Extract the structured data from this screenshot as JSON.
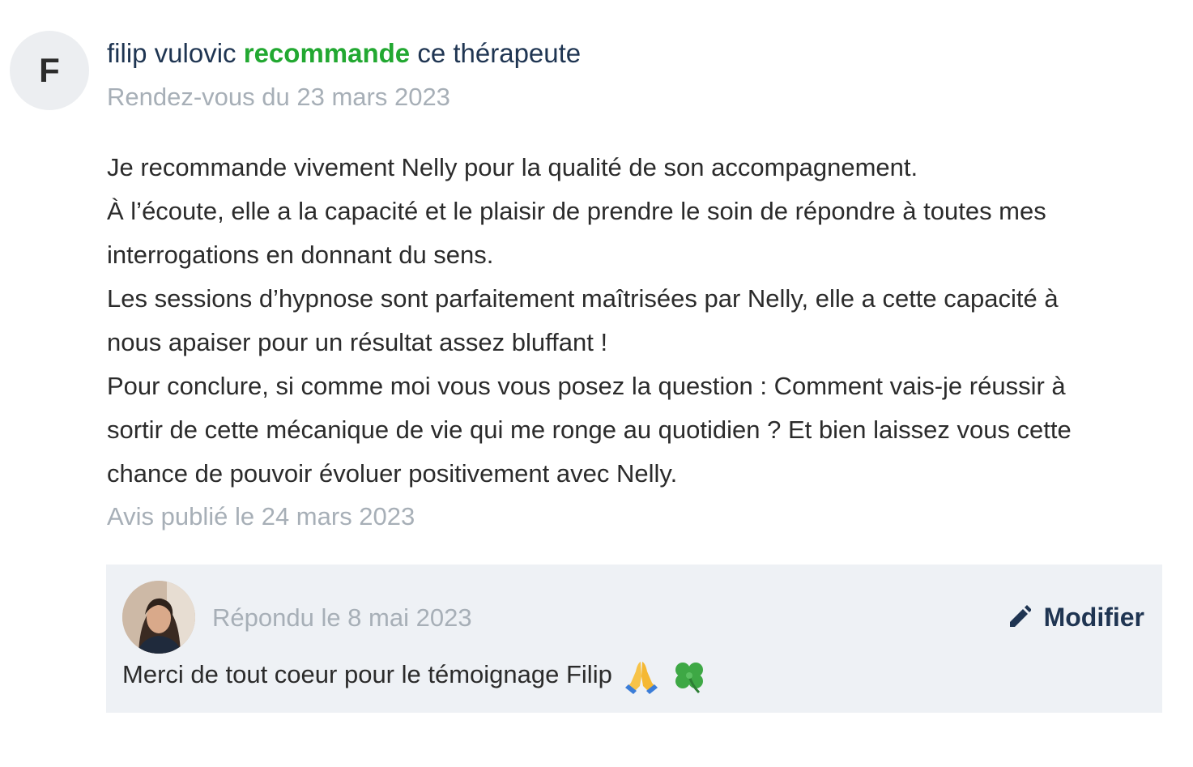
{
  "review": {
    "author_initial": "F",
    "author_name": "filip vulovic",
    "recommend_word": "recommande",
    "header_suffix": "ce thérapeute",
    "appointment_date": "Rendez-vous du 23 mars 2023",
    "body_lines": [
      "Je recommande vivement Nelly pour la qualité de son accompagnement.",
      "À l’écoute, elle a la capacité et le plaisir de prendre le soin de répondre à toutes mes",
      "interrogations en donnant du sens.",
      "Les sessions d’hypnose sont parfaitement maîtrisées par Nelly, elle a cette capacité à",
      "nous apaiser pour un résultat assez bluffant !",
      "Pour conclure, si comme moi vous vous posez la question : Comment vais-je réussir à",
      "sortir de cette mécanique de vie qui me ronge au quotidien ? Et bien laissez vous cette",
      "chance de pouvoir évoluer positivement avec Nelly."
    ],
    "published_date": "Avis publié le 24 mars 2023"
  },
  "reply": {
    "replied_date": "Répondu le 8 mai 2023",
    "modify_label": "Modifier",
    "text": "Merci de tout coeur pour le témoignage Filip",
    "emojis": [
      "folded-hands-icon",
      "four-leaf-clover-icon"
    ]
  },
  "colors": {
    "recommend_green": "#22a831",
    "name_navy": "#1f3552",
    "muted_gray": "#a7afb7",
    "reply_bg": "#eef1f5"
  }
}
